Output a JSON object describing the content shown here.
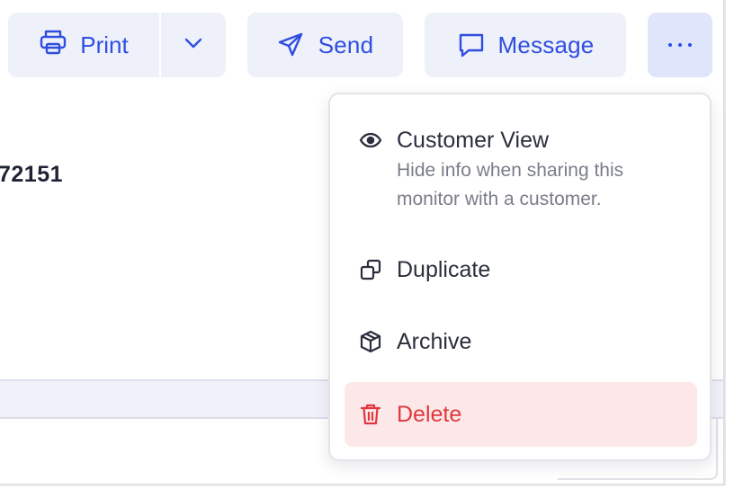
{
  "toolbar": {
    "print_label": "Print",
    "send_label": "Send",
    "message_label": "Message"
  },
  "content": {
    "partial_number": "72151"
  },
  "menu": {
    "customer_view": {
      "title": "Customer View",
      "description_line1": "Hide info when sharing this",
      "description_line2": "monitor with a customer."
    },
    "duplicate": {
      "title": "Duplicate"
    },
    "archive": {
      "title": "Archive"
    },
    "delete": {
      "title": "Delete"
    }
  },
  "colors": {
    "accent": "#2f4ee0",
    "button_bg": "#eef0fa",
    "active_button_bg": "#dfe6fb",
    "danger": "#e0383e",
    "danger_bg": "#fde8e9"
  },
  "icons": {
    "print": "printer-icon",
    "caret": "chevron-down-icon",
    "send": "paper-plane-icon",
    "message": "chat-bubble-icon",
    "more": "ellipsis-icon",
    "customer_view": "eye-icon",
    "duplicate": "copy-icon",
    "archive": "box-icon",
    "delete": "trash-icon"
  }
}
